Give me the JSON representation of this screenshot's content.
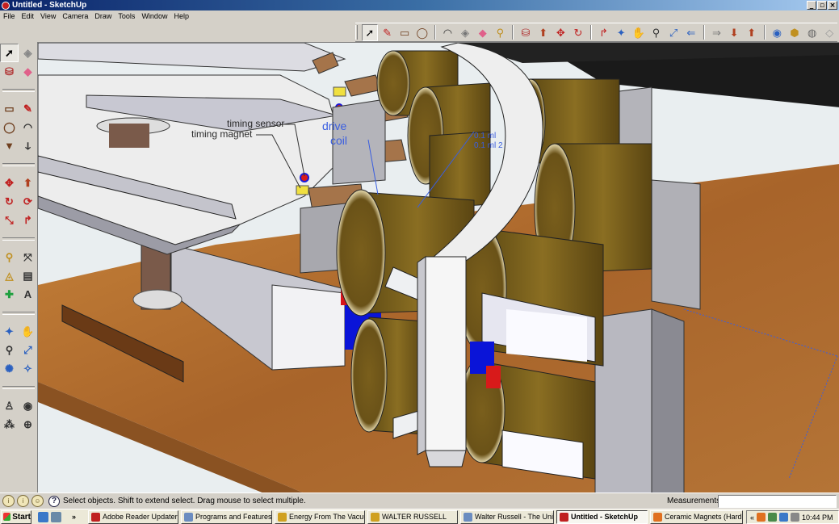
{
  "window": {
    "title": "Untitled - SketchUp"
  },
  "menu": [
    "File",
    "Edit",
    "View",
    "Camera",
    "Draw",
    "Tools",
    "Window",
    "Help"
  ],
  "toolbar": {
    "tools": [
      {
        "name": "select-tool",
        "glyph": "➚",
        "color": "#000000"
      },
      {
        "name": "pencil-tool",
        "glyph": "✎",
        "color": "#c02020"
      },
      {
        "name": "rectangle-tool",
        "glyph": "▭",
        "color": "#704020"
      },
      {
        "name": "circle-tool",
        "glyph": "◯",
        "color": "#704020"
      },
      {
        "name": "arc-tool",
        "glyph": "◠",
        "color": "#333333"
      },
      {
        "name": "make-component-tool",
        "glyph": "◈",
        "color": "#777777"
      },
      {
        "name": "eraser-tool",
        "glyph": "◆",
        "color": "#e0608a"
      },
      {
        "name": "tape-measure-tool",
        "glyph": "⚲",
        "color": "#c09020"
      },
      {
        "name": "paint-bucket-tool",
        "glyph": "⛁",
        "color": "#b03030"
      },
      {
        "name": "push-pull-tool",
        "glyph": "⬆",
        "color": "#b04020"
      },
      {
        "name": "move-tool",
        "glyph": "✥",
        "color": "#c02020"
      },
      {
        "name": "rotate-tool",
        "glyph": "↻",
        "color": "#c02020"
      },
      {
        "name": "offset-tool",
        "glyph": "↱",
        "color": "#c02020"
      },
      {
        "name": "orbit-tool",
        "glyph": "✦",
        "color": "#2a60c0"
      },
      {
        "name": "pan-tool",
        "glyph": "✋",
        "color": "#555555"
      },
      {
        "name": "zoom-tool",
        "glyph": "⚲",
        "color": "#333333"
      },
      {
        "name": "zoom-extents-tool",
        "glyph": "⤢",
        "color": "#2a60c0"
      },
      {
        "name": "previous-view-tool",
        "glyph": "⇐",
        "color": "#2a60c0"
      },
      {
        "name": "next-view-tool",
        "glyph": "⇒",
        "color": "#777777"
      },
      {
        "name": "get-models-tool",
        "glyph": "⬇",
        "color": "#b04020"
      },
      {
        "name": "share-model-tool",
        "glyph": "⬆",
        "color": "#b04020"
      },
      {
        "name": "share-component-tool",
        "glyph": "◉",
        "color": "#2a60c0"
      },
      {
        "name": "get-photo-texture-tool",
        "glyph": "⬢",
        "color": "#c09020"
      },
      {
        "name": "extension-tool",
        "glyph": "◍",
        "color": "#666666"
      },
      {
        "name": "layers-tool",
        "glyph": "◇",
        "color": "#999999"
      }
    ]
  },
  "sidebar": {
    "tools": [
      {
        "name": "select-tool",
        "glyph": "➚",
        "color": "#000000"
      },
      {
        "name": "make-component-tool",
        "glyph": "◈",
        "color": "#888888"
      },
      {
        "name": "paint-bucket-tool",
        "glyph": "⛁",
        "color": "#b03030"
      },
      {
        "name": "eraser-tool",
        "glyph": "◆",
        "color": "#e0608a"
      },
      {
        "name": "rectangle-tool",
        "glyph": "▭",
        "color": "#704020"
      },
      {
        "name": "line-tool",
        "glyph": "✎",
        "color": "#c02020"
      },
      {
        "name": "circle-tool",
        "glyph": "◯",
        "color": "#704020"
      },
      {
        "name": "arc-tool",
        "glyph": "◠",
        "color": "#333333"
      },
      {
        "name": "polygon-tool",
        "glyph": "▼",
        "color": "#704020"
      },
      {
        "name": "freehand-tool",
        "glyph": "ↆ",
        "color": "#333333"
      },
      {
        "name": "move-tool",
        "glyph": "✥",
        "color": "#c02020"
      },
      {
        "name": "push-pull-tool",
        "glyph": "⬆",
        "color": "#b04020"
      },
      {
        "name": "rotate-tool",
        "glyph": "↻",
        "color": "#c02020"
      },
      {
        "name": "follow-me-tool",
        "glyph": "⟳",
        "color": "#c02020"
      },
      {
        "name": "scale-tool",
        "glyph": "⤡",
        "color": "#c02020"
      },
      {
        "name": "offset-tool",
        "glyph": "↱",
        "color": "#c02020"
      },
      {
        "name": "tape-measure-tool",
        "glyph": "⚲",
        "color": "#c09020"
      },
      {
        "name": "dimension-tool",
        "glyph": "⤧",
        "color": "#333333"
      },
      {
        "name": "protractor-tool",
        "glyph": "◬",
        "color": "#c09020"
      },
      {
        "name": "text-tool",
        "glyph": "▤",
        "color": "#333333"
      },
      {
        "name": "axes-tool",
        "glyph": "✚",
        "color": "#20a040"
      },
      {
        "name": "3d-text-tool",
        "glyph": "A",
        "color": "#333333"
      },
      {
        "name": "orbit-tool",
        "glyph": "✦",
        "color": "#2a60c0"
      },
      {
        "name": "pan-tool",
        "glyph": "✋",
        "color": "#555555"
      },
      {
        "name": "zoom-tool",
        "glyph": "⚲",
        "color": "#333333"
      },
      {
        "name": "zoom-window-tool",
        "glyph": "⤢",
        "color": "#2a60c0"
      },
      {
        "name": "zoom-extents-tool",
        "glyph": "✺",
        "color": "#2a60c0"
      },
      {
        "name": "previous-view-tool",
        "glyph": "✧",
        "color": "#2a60c0"
      },
      {
        "name": "position-camera-tool",
        "glyph": "♙",
        "color": "#333333"
      },
      {
        "name": "look-around-tool",
        "glyph": "◉",
        "color": "#333333"
      },
      {
        "name": "walk-tool",
        "glyph": "⁂",
        "color": "#333333"
      },
      {
        "name": "section-plane-tool",
        "glyph": "⊕",
        "color": "#333333"
      }
    ]
  },
  "viewport": {
    "labels": {
      "timing_sensor": "timing sensor",
      "timing_magnet": "timing magnet",
      "drive_coil_1": "drive",
      "drive_coil_2": "coil",
      "dim_1": "0.1 ml",
      "dim_2": "0.1 ml 2"
    }
  },
  "status": {
    "text": "Select objects. Shift to extend select. Drag mouse to select multiple.",
    "measurements_label": "Measurements",
    "measurements_value": ""
  },
  "taskbar": {
    "start_label": "Start",
    "tasks": [
      {
        "label": "Adobe Reader Updater",
        "color": "#c02020",
        "active": false
      },
      {
        "label": "Programs and Features",
        "color": "#6b8cc0",
        "active": false
      },
      {
        "label": "Energy From The Vacuum",
        "color": "#d0a020",
        "active": false
      },
      {
        "label": "WALTER RUSSELL",
        "color": "#d0a020",
        "active": false
      },
      {
        "label": "Walter Russell - The Uni...",
        "color": "#6b8cc0",
        "active": false
      },
      {
        "label": "Untitled - SketchUp",
        "color": "#c02020",
        "active": true
      },
      {
        "label": "Ceramic Magnets (Hard ...",
        "color": "#e07020",
        "active": false
      }
    ],
    "clock": "10:44 PM"
  }
}
